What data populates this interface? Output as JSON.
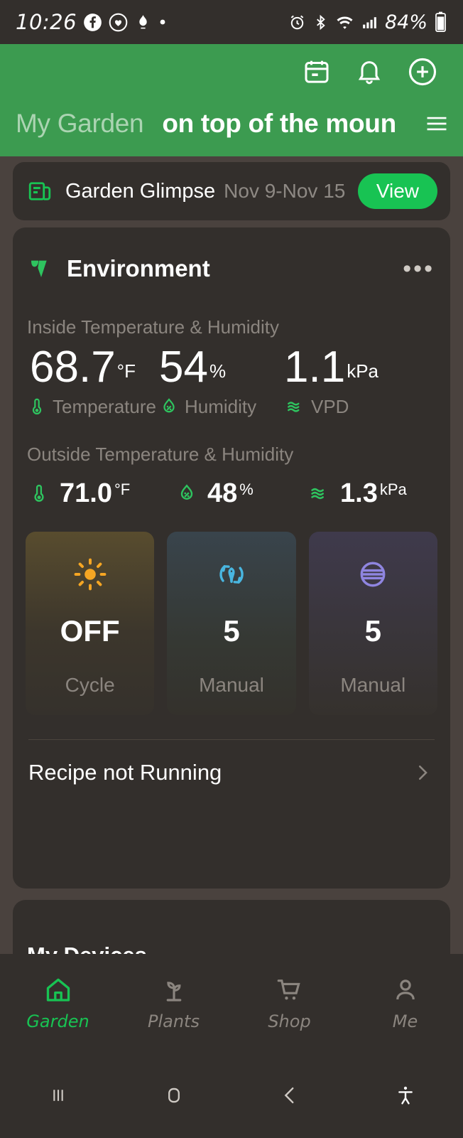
{
  "status_bar": {
    "time": "10:26",
    "battery_percent": "84%",
    "left_icons": [
      "facebook-icon",
      "heart-app-icon",
      "app-icon",
      "dot-indicator"
    ],
    "right_icons": [
      "alarm-icon",
      "bluetooth-icon",
      "wifi-icon",
      "signal-icon",
      "battery-icon"
    ]
  },
  "header": {
    "my_garden_label": "My Garden",
    "selected_garden": "on top of the mount",
    "actions": [
      "calendar-icon",
      "bell-icon",
      "add-circle-icon",
      "hamburger-menu-icon"
    ],
    "background_color": "#3c9b50"
  },
  "glimpse": {
    "icon": "newspaper-icon",
    "title": "Garden Glimpse",
    "date_range": "Nov 9-Nov 15",
    "view_button": "View",
    "button_color": "#18c353"
  },
  "environment": {
    "logo": "ac-infinity-leaf-logo",
    "title": "Environment",
    "overflow_menu": "more-options-icon",
    "inside_label": "Inside Temperature & Humidity",
    "inside": [
      {
        "value": "68.7",
        "unit": "°F",
        "label": "Temperature",
        "icon": "thermometer-icon"
      },
      {
        "value": "54",
        "unit": "%",
        "label": "Humidity",
        "icon": "humidity-drop-icon"
      },
      {
        "value": "1.1",
        "unit": "kPa",
        "label": "VPD",
        "icon": "vpd-waves-icon"
      }
    ],
    "outside_label": "Outside Temperature & Humidity",
    "outside": [
      {
        "value": "71.0",
        "unit": "°F",
        "icon": "thermometer-icon"
      },
      {
        "value": "48",
        "unit": "%",
        "icon": "humidity-drop-icon"
      },
      {
        "value": "1.3",
        "unit": "kPa",
        "icon": "vpd-waves-icon"
      }
    ],
    "devices": [
      {
        "icon": "sun-icon",
        "icon_color": "#f5a623",
        "value": "OFF",
        "mode": "Cycle"
      },
      {
        "icon": "circulation-leaf-icon",
        "icon_color": "#49b6e0",
        "value": "5",
        "mode": "Manual"
      },
      {
        "icon": "humidifier-circle-icon",
        "icon_color": "#8f85e0",
        "value": "5",
        "mode": "Manual"
      }
    ],
    "recipe_status": "Recipe not Running",
    "recipe_chevron": "chevron-right-icon"
  },
  "my_devices": {
    "title": "My Devices"
  },
  "bottom_nav": {
    "items": [
      {
        "label": "Garden",
        "icon": "home-icon",
        "active": true
      },
      {
        "label": "Plants",
        "icon": "sprout-icon",
        "active": false
      },
      {
        "label": "Shop",
        "icon": "cart-icon",
        "active": false
      },
      {
        "label": "Me",
        "icon": "person-icon",
        "active": false
      }
    ],
    "active_color": "#18c353"
  },
  "android_nav": {
    "buttons": [
      "recents-icon",
      "home-icon",
      "back-icon",
      "accessibility-icon"
    ]
  }
}
